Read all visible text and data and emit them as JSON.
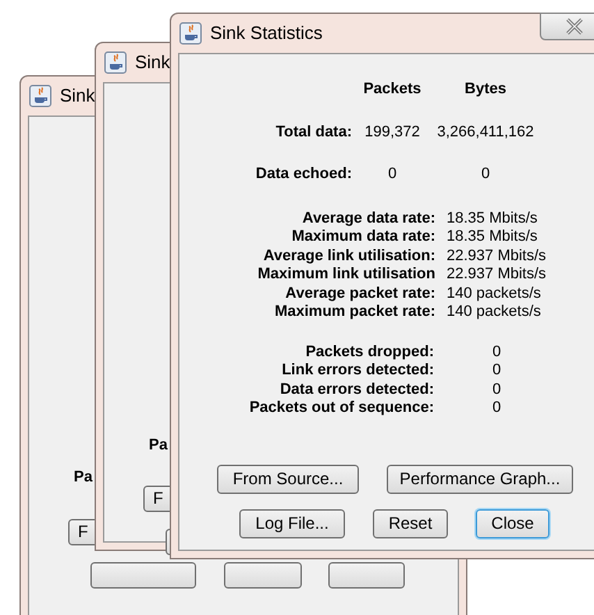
{
  "back_windows": [
    {
      "title": "Sink",
      "label": "Pa",
      "button": "F"
    },
    {
      "title": "Sink",
      "label": "Pa",
      "button": "F"
    }
  ],
  "window": {
    "title": "Sink Statistics",
    "columns": [
      "Packets",
      "Bytes"
    ],
    "totals": [
      {
        "label": "Total data:",
        "packets": "199,372",
        "bytes": "3,266,411,162"
      },
      {
        "label": "Data echoed:",
        "packets": "0",
        "bytes": "0"
      }
    ],
    "rates": [
      {
        "label": "Average data rate:",
        "value": "18.35 Mbits/s"
      },
      {
        "label": "Maximum data rate:",
        "value": "18.35 Mbits/s"
      },
      {
        "label": "Average link utilisation:",
        "value": "22.937 Mbits/s"
      },
      {
        "label": "Maximum link utilisation",
        "value": "22.937 Mbits/s"
      },
      {
        "label": "Average packet rate:",
        "value": "140 packets/s"
      },
      {
        "label": "Maximum packet rate:",
        "value": "140 packets/s"
      }
    ],
    "errors": [
      {
        "label": "Packets dropped:",
        "value": "0"
      },
      {
        "label": "Link errors detected:",
        "value": "0"
      },
      {
        "label": "Data errors detected:",
        "value": "0"
      },
      {
        "label": "Packets out of sequence:",
        "value": "0"
      }
    ],
    "button_rows": [
      [
        {
          "label": "From Source...",
          "focused": false
        },
        {
          "label": "Performance Graph...",
          "focused": false
        }
      ],
      [
        {
          "label": "Log File...",
          "focused": false
        },
        {
          "label": "Reset",
          "focused": false
        },
        {
          "label": "Close",
          "focused": true
        }
      ]
    ]
  }
}
